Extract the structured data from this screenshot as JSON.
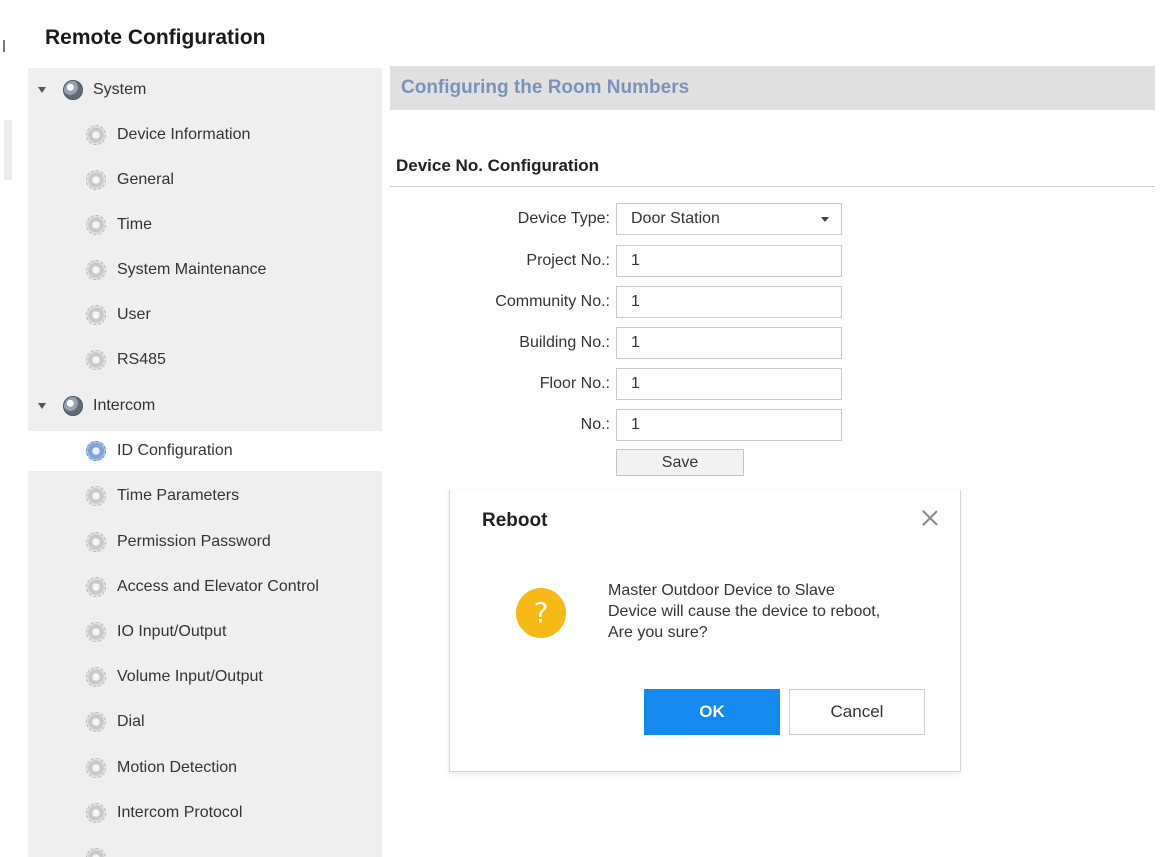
{
  "app": {
    "title": "Remote Configuration"
  },
  "sidebar": {
    "groups": [
      {
        "label": "System",
        "expanded": true
      },
      {
        "label": "Intercom",
        "expanded": true
      }
    ],
    "system_items": [
      "Device Information",
      "General",
      "Time",
      "System Maintenance",
      "User",
      "RS485"
    ],
    "intercom_items": [
      "ID Configuration",
      "Time Parameters",
      "Permission Password",
      "Access and Elevator Control",
      "IO Input/Output",
      "Volume Input/Output",
      "Dial",
      "Motion Detection",
      "Intercom Protocol"
    ],
    "selected": "ID Configuration"
  },
  "main": {
    "section_title": "Configuring the Room Numbers",
    "subsection_title": "Device No. Configuration",
    "form": {
      "device_type": {
        "label": "Device Type:",
        "value": "Door Station"
      },
      "project_no": {
        "label": "Project No.:",
        "value": "1"
      },
      "community_no": {
        "label": "Community No.:",
        "value": "1"
      },
      "building_no": {
        "label": "Building No.:",
        "value": "1"
      },
      "floor_no": {
        "label": "Floor No.:",
        "value": "1"
      },
      "no": {
        "label": "No.:",
        "value": "1"
      },
      "save_label": "Save"
    }
  },
  "dialog": {
    "title": "Reboot",
    "icon": "question-icon",
    "icon_glyph": "?",
    "message_lines": [
      "Master Outdoor Device to Slave",
      "Device will cause the device to reboot,",
      "Are you sure?"
    ],
    "ok_label": "OK",
    "cancel_label": "Cancel"
  },
  "colors": {
    "accent_blue": "#1489f0",
    "section_title": "#7a93bd",
    "warning": "#f6b915",
    "sidebar_bg": "#efefef"
  }
}
